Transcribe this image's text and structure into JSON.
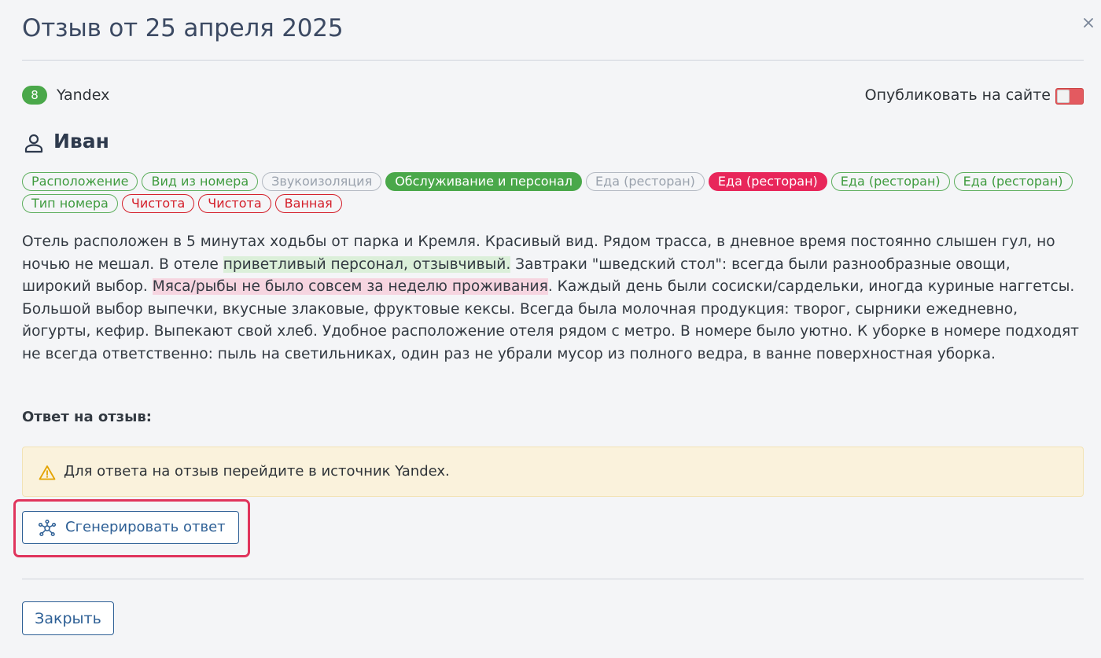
{
  "modal": {
    "title": "Отзыв от 25 апреля 2025",
    "close_icon": "close-icon"
  },
  "source": {
    "rating": "8",
    "name": "Yandex",
    "publish_label": "Опубликовать на сайте",
    "publish_enabled": false
  },
  "author": {
    "icon": "person-icon",
    "name": "Иван"
  },
  "tags": [
    {
      "label": "Расположение",
      "sentiment": "positive"
    },
    {
      "label": "Вид из номера",
      "sentiment": "positive"
    },
    {
      "label": "Звукоизоляция",
      "sentiment": "neutral"
    },
    {
      "label": "Обслуживание и персонал",
      "sentiment": "positive-selected"
    },
    {
      "label": "Еда (ресторан)",
      "sentiment": "neutral"
    },
    {
      "label": "Еда (ресторан)",
      "sentiment": "negative-selected"
    },
    {
      "label": "Еда (ресторан)",
      "sentiment": "positive"
    },
    {
      "label": "Еда (ресторан)",
      "sentiment": "positive"
    },
    {
      "label": "Тип номера",
      "sentiment": "positive"
    },
    {
      "label": "Чистота",
      "sentiment": "negative"
    },
    {
      "label": "Чистота",
      "sentiment": "negative"
    },
    {
      "label": "Ванная",
      "sentiment": "negative"
    }
  ],
  "review": {
    "part1": "Отель расположен в 5 минутах ходьбы от парка и Кремля. Красивый вид. Рядом трасса, в дневное время постоянно слышен гул, но ночью не мешал. В отеле ",
    "highlight_positive": "приветливый персонал, отзывчивый.",
    "part2": " Завтраки \"шведский стол\": всегда были разнообразные овощи, широкий выбор. ",
    "highlight_negative": "Мяса/рыбы не было совсем за неделю проживания",
    "part3": ". Каждый день были сосиски/сардельки, иногда куриные наггетсы. Большой выбор выпечки, вкусные злаковые, фруктовые кексы. Всегда была молочная продукция: творог, сырники ежедневно, йогурты, кефир. Выпекают свой хлеб. Удобное расположение отеля рядом с метро. В номере было уютно. К уборке в номере подходят не всегда ответственно: пыль на светильниках, один раз не убрали мусор из полного ведра, в ванне поверхностная уборка."
  },
  "reply": {
    "label": "Ответ на отзыв:",
    "warning_icon": "warning-icon",
    "alert_text": "Для ответа на отзыв перейдите в источник Yandex.",
    "generate_icon": "network-icon",
    "generate_label": "Сгенерировать ответ"
  },
  "footer": {
    "close_label": "Закрыть"
  },
  "colors": {
    "positive": "#4aa84a",
    "negative": "#d41f2a",
    "negative_selected": "#e8265a",
    "neutral": "#9aa2ad",
    "accent": "#2d5f95",
    "highlight_frame": "#e0345c"
  }
}
